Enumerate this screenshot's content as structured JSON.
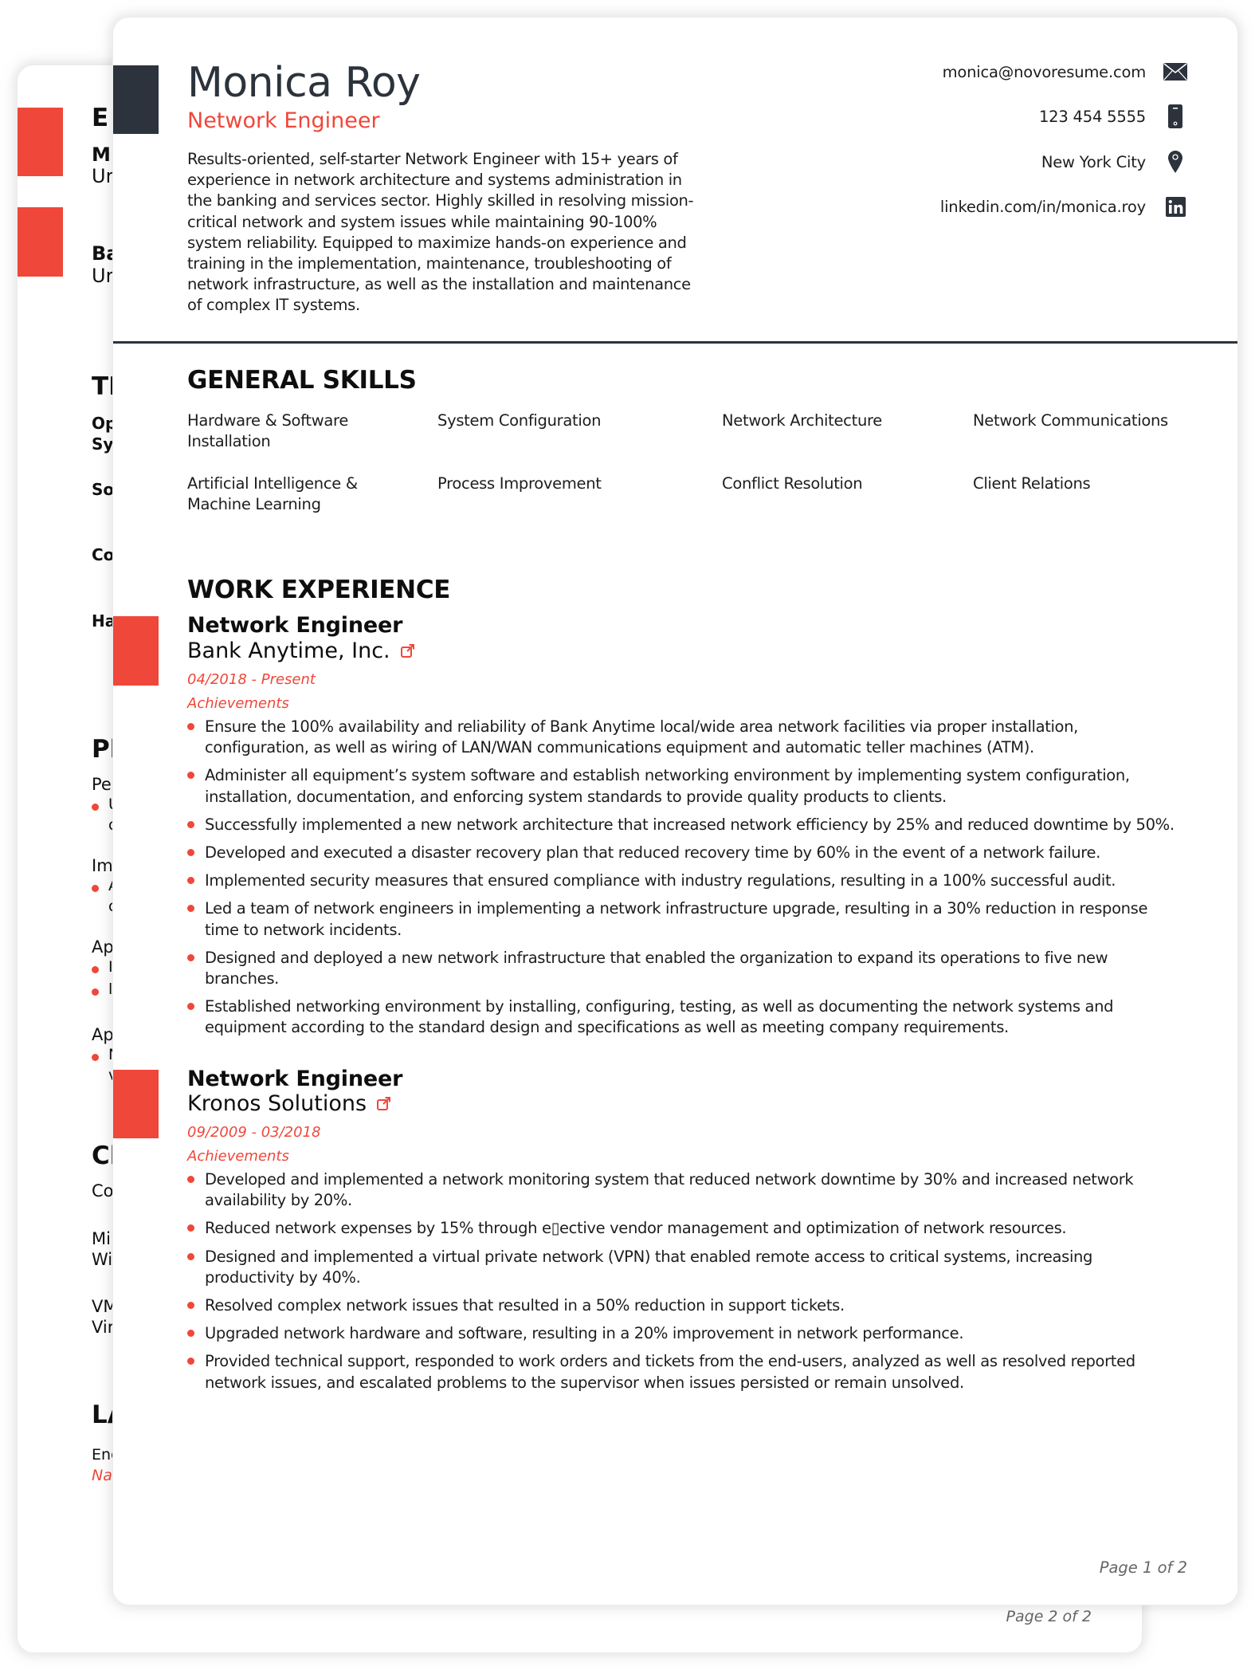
{
  "resume": {
    "name": "Monica Roy",
    "title": "Network Engineer",
    "summary": "Results-oriented, self-starter Network Engineer with 15+ years of experience in network architecture and systems administration in the banking and services sector. Highly skilled in resolving mission-critical network and system issues while maintaining 90-100% system reliability. Equipped to maximize hands-on experience and training in the implementation, maintenance, troubleshooting of network infrastructure, as well as the installation and maintenance of complex IT systems.",
    "contacts": [
      {
        "text": "monica@novoresume.com",
        "icon": "envelope-icon"
      },
      {
        "text": "123 454 5555",
        "icon": "phone-icon"
      },
      {
        "text": "New York City",
        "icon": "location-pin-icon"
      },
      {
        "text": "linkedin.com/in/monica.roy",
        "icon": "linkedin-icon"
      }
    ],
    "accent_color": "#ef473a",
    "dark_color": "#2c333c"
  },
  "skills": {
    "heading": "GENERAL SKILLS",
    "items": [
      "Hardware & Software Installation",
      "System Configuration",
      "Network Architecture",
      "Network Communications",
      "Artificial Intelligence & Machine Learning",
      "Process Improvement",
      "Conflict Resolution",
      "Client Relations"
    ]
  },
  "experience": {
    "heading": "WORK EXPERIENCE",
    "jobs": [
      {
        "title": "Network Engineer",
        "company": "Bank Anytime, Inc.",
        "dates": "04/2018 - Present",
        "achievements_label": "Achievements",
        "bullets": [
          "Ensure the 100% availability and reliability of Bank Anytime local/wide area network facilities via proper installation, configuration, as well as wiring of LAN/WAN communications equipment and automatic teller machines (ATM).",
          "Administer all equipment’s system software and establish networking environment by implementing system configuration, installation, documentation, and enforcing system standards to provide quality products to clients.",
          "Successfully implemented a new network architecture that increased network efficiency by 25% and reduced downtime by 50%.",
          "Developed and executed a disaster recovery plan that reduced recovery time by 60% in the event of a network failure.",
          "Implemented security measures that ensured compliance with industry regulations, resulting in a 100% successful audit.",
          "Led a team of network engineers in implementing a network infrastructure upgrade, resulting in a 30% reduction in response time to network incidents.",
          "Designed and deployed a new network infrastructure that enabled the organization to expand its operations to five new branches.",
          "Established networking environment by installing, configuring, testing, as well as documenting the network systems and equipment according to the standard design and specifications as well as meeting company requirements."
        ]
      },
      {
        "title": "Network Engineer",
        "company": "Kronos Solutions",
        "dates": "09/2009 - 03/2018",
        "achievements_label": "Achievements",
        "bullets": [
          "Developed and implemented a network monitoring system that reduced network downtime by 30% and increased network availability by 20%.",
          "Reduced network expenses by 15% through e▯ective vendor management and optimization of network resources.",
          "Designed and implemented a virtual private network (VPN) that enabled remote access to critical systems, increasing productivity by 40%.",
          "Resolved complex network issues that resulted in a 50% reduction in support tickets.",
          "Upgraded network hardware and software, resulting in a 20% improvement in network performance.",
          "Provided technical support, responded to work orders and tickets from the end-users, analyzed as well as resolved reported network issues, and escalated problems to the supervisor when issues persisted or remain unsolved."
        ]
      }
    ]
  },
  "page1_footer": "Page 1 of 2",
  "page2": {
    "footer": "Page 2 of 2",
    "visible_fragments": {
      "education_heading": "E",
      "edu1_degree": "M",
      "edu1_school": "Ur",
      "edu2_degree": "Ba",
      "edu2_school": "Ur",
      "tech_heading": "TI",
      "tech1_line1": "Op",
      "tech1_line2": "Sys",
      "tech2": "So",
      "tech3": "Co",
      "tech4": "Ha",
      "projects_heading": "Pl",
      "proj1": "Pe",
      "proj1_b1_l1": "U",
      "proj1_b1_l2": "c",
      "proj2": "Im",
      "proj2_b1_l1": "A",
      "proj2_b1_l2": "c",
      "proj3": "Ap",
      "proj3_b1": "I",
      "proj3_b2": "l",
      "proj4": "Ap",
      "proj4_b1_l1": "N",
      "proj4_b1_l2": "v",
      "cert_heading": "Cl",
      "cert1": "Co",
      "cert2_l1": "Mi",
      "cert2_l2": "Wi",
      "cert3_l1": "VM",
      "cert3_l2": "Vir",
      "lang_heading": "LA",
      "lang1": "Eng",
      "lang1_level": "Na"
    }
  }
}
